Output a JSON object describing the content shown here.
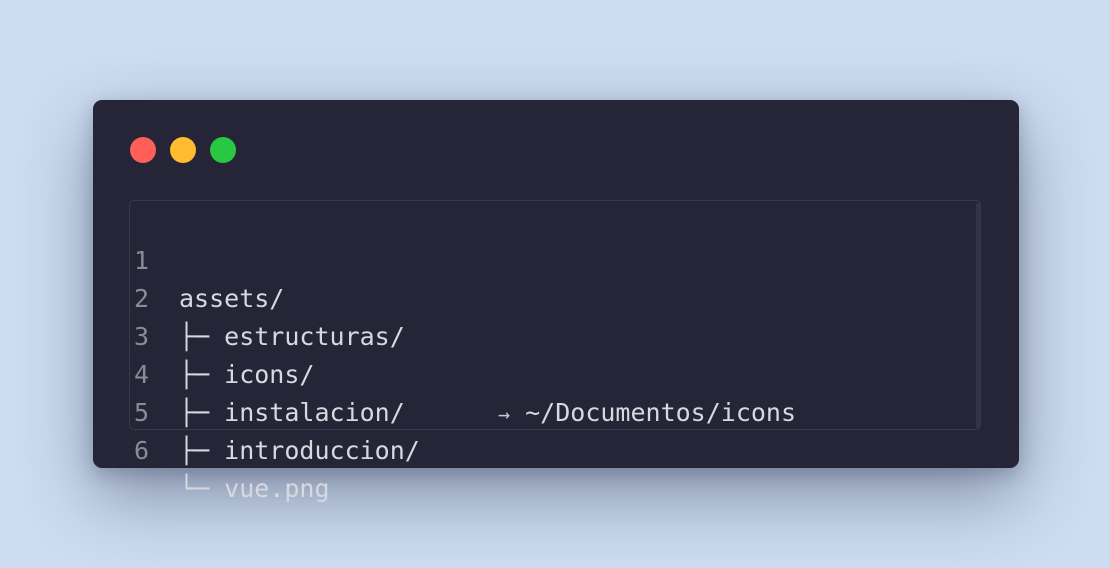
{
  "window": {
    "controls": {
      "close": "red-dot",
      "minimize": "yellow-dot",
      "maximize": "green-dot"
    },
    "colors": {
      "background": "#262537",
      "text": "#d8d8e0",
      "line_numbers": "#8a8a98"
    }
  },
  "code": {
    "lines": [
      {
        "number": "1",
        "text": "assets/",
        "link": null
      },
      {
        "number": "2",
        "text": "├─ estructuras/",
        "link": null
      },
      {
        "number": "3",
        "text": "├─ icons/",
        "link": "~/Documentos/icons",
        "arrow": "→"
      },
      {
        "number": "4",
        "text": "├─ instalacion/",
        "link": null
      },
      {
        "number": "5",
        "text": "├─ introduccion/",
        "link": null
      },
      {
        "number": "6",
        "text": "└─ vue.png",
        "link": null
      }
    ]
  }
}
